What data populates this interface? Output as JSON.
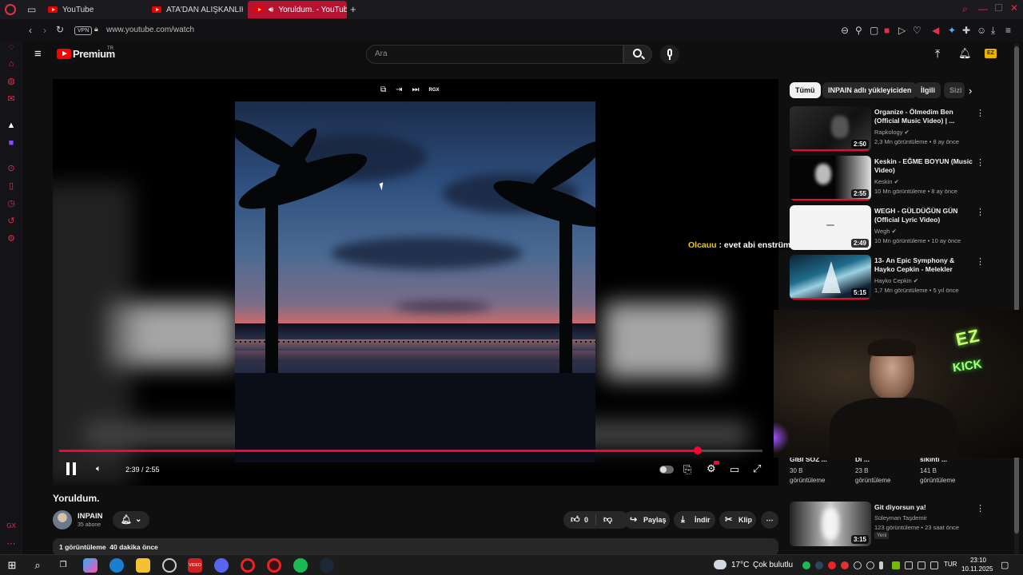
{
  "browser": {
    "tabs": [
      {
        "label": "YouTube",
        "active": false
      },
      {
        "label": "ATA'DAN ALIŞKANLIK | M",
        "active": false
      },
      {
        "label": "Yoruldum. - YouTube",
        "active": true
      }
    ],
    "vpn_label": "VPN",
    "url": "www.youtube.com/watch"
  },
  "youtube": {
    "logo_text": "Premium",
    "logo_sup": "TR",
    "search_placeholder": "Ara"
  },
  "player": {
    "time_current": "2:39",
    "time_sep": " / ",
    "time_total": "2:55",
    "progress_fraction": 0.908,
    "top_overlay_label": "RGX"
  },
  "chat_overlay": {
    "user": "Olcauu",
    "message": " : evet abi enstrüman ve iflic yaptı"
  },
  "chips": [
    "Tümü",
    "INPAIN adlı yükleyiciden",
    "İlgili",
    "Sizi"
  ],
  "recommendations": [
    {
      "title": "Organize - Ölmedim Ben (Official Music Video) | ...",
      "channel": "Rapkology",
      "meta": "2,3 Mn görüntüleme • 8 ay önce",
      "duration": "2:50"
    },
    {
      "title": "Keskin - EĞME BOYUN (Music Video)",
      "channel": "Keskin",
      "meta": "10 Mn görüntüleme • 8 ay önce",
      "duration": "2:55"
    },
    {
      "title": "WEGH - GÜLDÜĞÜN GÜN (Official Lyric Video)",
      "channel": "Wegh",
      "meta": "10 Mn görüntüleme • 10 ay önce",
      "duration": "2:49"
    },
    {
      "title": "13- An Epic Symphony & Hayko Cepkin - Melekler",
      "channel": "Hayko Cepkin",
      "meta": "1,7 Mn görüntüleme • 5 yıl önce",
      "duration": "5:15"
    }
  ],
  "shorts_row": [
    {
      "title": "GIBI SÖZ ...",
      "views": "30 B",
      "views_label": "görüntüleme"
    },
    {
      "title": "Di ...",
      "views": "23 B",
      "views_label": "görüntüleme"
    },
    {
      "title": "sıkıntı ...",
      "views": "141 B",
      "views_label": "görüntüleme"
    }
  ],
  "rec_bottom": {
    "title": "Git diyorsun ya!",
    "channel": "Süleyman Taşdemir",
    "meta": "123 görüntüleme • 23 saat önce",
    "badge": "Yeni",
    "duration": "3:15"
  },
  "video": {
    "title": "Yoruldum.",
    "channel_name": "INPAIN",
    "subscribers": "35 abone",
    "likes": "0",
    "share_label": "Paylaş",
    "download_label": "İndir",
    "clip_label": "Klip",
    "views": "1 görüntüleme",
    "age": "40 dakika önce"
  },
  "webcam": {
    "sign_top": "EZ",
    "sign_bottom": "KICK"
  },
  "taskbar": {
    "weather_temp": "17°C",
    "weather_desc": "Çok bulutlu",
    "lang": "TUR",
    "time": "23:10",
    "date": "10.11.2025"
  },
  "colors": {
    "accent": "#ff0033",
    "opera_red": "#e0304a",
    "neon_green": "#7dff6a"
  }
}
